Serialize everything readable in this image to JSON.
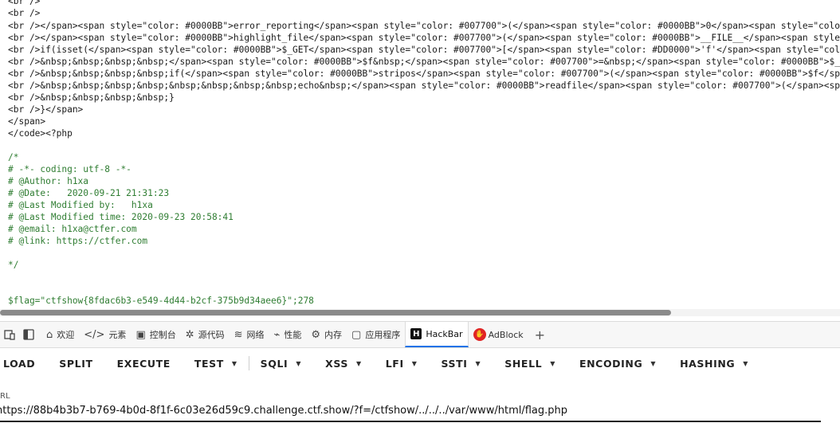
{
  "source": {
    "lines": [
      "<br />",
      "<br />",
      "<br /></span><span style=\"color: #0000BB\">error_reporting</span><span style=\"color: #007700\">(</span><span style=\"color: #0000BB\">0</span><span style=\"color: #00",
      "<br /></span><span style=\"color: #0000BB\">highlight_file</span><span style=\"color: #007700\">(</span><span style=\"color: #0000BB\">__FILE__</span><span style=\"colo",
      "<br />if(isset(</span><span style=\"color: #0000BB\">$_GET</span><span style=\"color: #007700\">[</span><span style=\"color: #DD0000\">'f'</span><span style=\"color: #0",
      "<br />&nbsp;&nbsp;&nbsp;&nbsp;</span><span style=\"color: #0000BB\">$f&nbsp;</span><span style=\"color: #007700\">=&nbsp;</span><span style=\"color: #0000BB\">$_GET</s",
      "<br />&nbsp;&nbsp;&nbsp;&nbsp;if(</span><span style=\"color: #0000BB\">stripos</span><span style=\"color: #007700\">(</span><span style=\"color: #0000BB\">$f</span><span",
      "<br />&nbsp;&nbsp;&nbsp;&nbsp;&nbsp;&nbsp;&nbsp;&nbsp;echo&nbsp;</span><span style=\"color: #0000BB\">readfile</span><span style=\"color: #007700\">(</span><span sty",
      "<br />&nbsp;&nbsp;&nbsp;&nbsp;}",
      "<br />}</span>",
      "</span>",
      "</code><?php"
    ],
    "comment_lines": [
      "/*",
      "# -*- coding: utf-8 -*-",
      "# @Author: h1xa",
      "# @Date:   2020-09-21 21:31:23",
      "# @Last Modified by:   h1xa",
      "# @Last Modified time: 2020-09-23 20:58:41",
      "# @email: h1xa@ctfer.com",
      "# @link: https://ctfer.com",
      "",
      "*/"
    ],
    "flag_line": "$flag=\"ctfshow{8fdac6b3-e549-4d44-b2cf-375b9d34aee6}\";278"
  },
  "devtools": {
    "tabs": [
      {
        "label": "欢迎",
        "icon": "home-icon"
      },
      {
        "label": "元素",
        "icon": "code-brackets-icon"
      },
      {
        "label": "控制台",
        "icon": "console-icon"
      },
      {
        "label": "源代码",
        "icon": "bug-icon"
      },
      {
        "label": "网络",
        "icon": "wifi-icon"
      },
      {
        "label": "性能",
        "icon": "performance-icon"
      },
      {
        "label": "内存",
        "icon": "gear-icon"
      },
      {
        "label": "应用程序",
        "icon": "app-window-icon"
      },
      {
        "label": "HackBar",
        "icon": "hackbar-logo-icon"
      },
      {
        "label": "AdBlock",
        "icon": "adblock-logo-icon"
      }
    ],
    "active_tab": "HackBar",
    "add_tab_icon": "plus-icon"
  },
  "hackbar": {
    "buttons": {
      "load": "LOAD",
      "split": "SPLIT",
      "execute": "EXECUTE",
      "test": "TEST",
      "sqli": "SQLI",
      "xss": "XSS",
      "lfi": "LFI",
      "ssti": "SSTI",
      "shell": "SHELL",
      "encoding": "ENCODING",
      "hashing": "HASHING"
    },
    "url_label": "RL",
    "url_value": "https://88b4b3b7-b769-4b0d-8f1f-6c03e26d59c9.challenge.ctf.show/?f=/ctfshow/../../../var/www/html/flag.php"
  }
}
